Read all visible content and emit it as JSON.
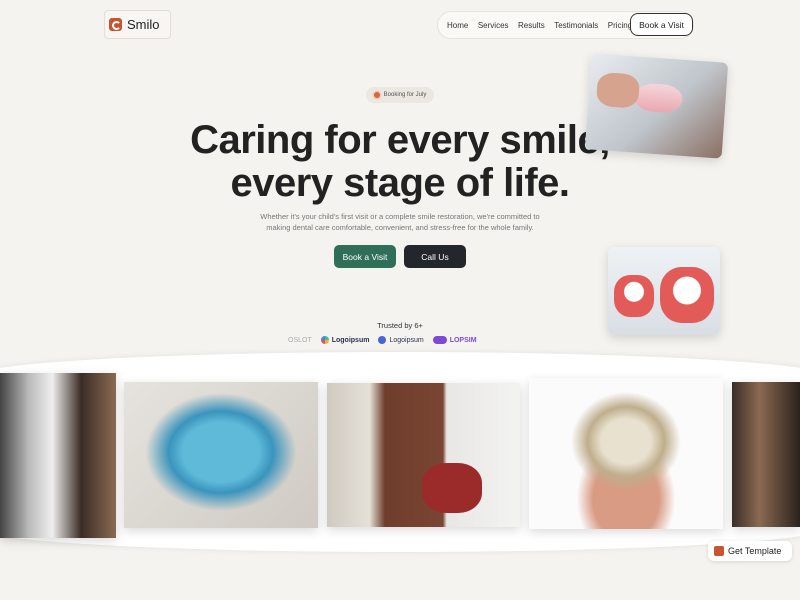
{
  "brand": {
    "name": "Smilo",
    "accent": "#c8552f"
  },
  "nav": {
    "items": [
      "Home",
      "Services",
      "Results",
      "Testimonials",
      "Pricing"
    ],
    "cta": "Book a Visit"
  },
  "hero": {
    "badge": "Booking for July",
    "title_line1": "Caring for every smile,",
    "title_line2": "every stage of life.",
    "subtitle": "Whether it's your child's first visit or a complete smile restoration, we're committed to making dental care comfortable, convenient, and stress-free for the whole family.",
    "primary_cta": "Book a Visit",
    "secondary_cta": "Call Us",
    "primary_color": "#2f6e58",
    "secondary_color": "#23262a"
  },
  "trust": {
    "label": "Trusted by 6+",
    "logos": [
      "OSLOT",
      "Logoipsum",
      "Logoipsum",
      "LOPSIM"
    ]
  },
  "gallery": {
    "photos": [
      "dentist-xray-photo",
      "clear-aligner-photo",
      "dental-clinic-photo",
      "denture-model-photo",
      "xray-panel-photo"
    ]
  },
  "footer": {
    "template_button": "Get Template"
  }
}
